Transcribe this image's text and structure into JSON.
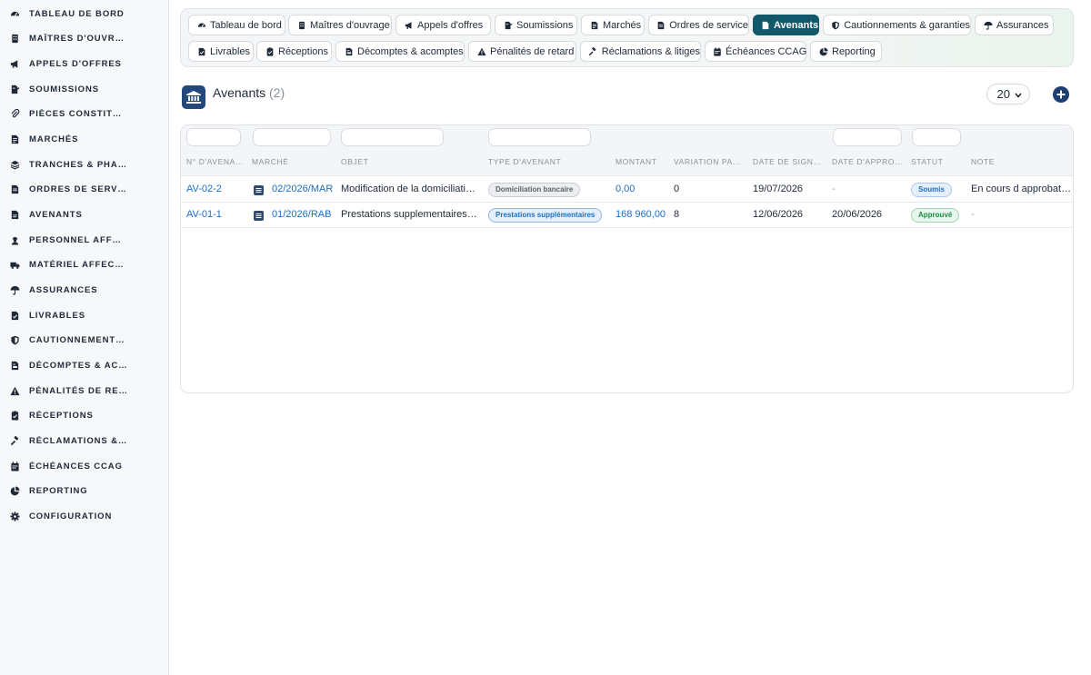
{
  "sidebar": {
    "items": [
      {
        "label": "Tableau de bord",
        "icon": "gauge-icon"
      },
      {
        "label": "Maîtres d'ouvrage",
        "icon": "building-icon"
      },
      {
        "label": "Appels d'offres",
        "icon": "megaphone-icon"
      },
      {
        "label": "Soumissions",
        "icon": "file-signature-icon"
      },
      {
        "label": "Pièces constitutives",
        "icon": "paperclip-icon"
      },
      {
        "label": "Marchés",
        "icon": "file-contract-icon"
      },
      {
        "label": "Tranches & phases",
        "icon": "layers-icon"
      },
      {
        "label": "Ordres de service",
        "icon": "file-lines-icon"
      },
      {
        "label": "Avenants",
        "icon": "file-icon"
      },
      {
        "label": "Personnel affecté",
        "icon": "user-hardhat-icon"
      },
      {
        "label": "Matériel affecté",
        "icon": "truck-icon"
      },
      {
        "label": "Assurances",
        "icon": "umbrella-icon"
      },
      {
        "label": "Livrables",
        "icon": "file-check-icon"
      },
      {
        "label": "Cautionnements & garanties",
        "icon": "shield-icon"
      },
      {
        "label": "Décomptes & acomptes",
        "icon": "invoice-icon"
      },
      {
        "label": "Pénalités de retard",
        "icon": "warning-icon"
      },
      {
        "label": "Réceptions",
        "icon": "clipboard-check-icon"
      },
      {
        "label": "Réclamations & litiges",
        "icon": "gavel-icon"
      },
      {
        "label": "Échéances CCAG",
        "icon": "calendar-icon"
      },
      {
        "label": "Reporting",
        "icon": "chart-pie-icon"
      },
      {
        "label": "Configuration",
        "icon": "gear-icon"
      }
    ]
  },
  "nav": {
    "tabs": [
      {
        "label": "Tableau de bord",
        "icon": "gauge-icon",
        "active": false
      },
      {
        "label": "Maîtres d'ouvrage",
        "icon": "building-icon",
        "active": false
      },
      {
        "label": "Appels d'offres",
        "icon": "megaphone-icon",
        "active": false
      },
      {
        "label": "Soumissions",
        "icon": "file-signature-icon",
        "active": false
      },
      {
        "label": "Marchés",
        "icon": "file-contract-icon",
        "active": false
      },
      {
        "label": "Ordres de service",
        "icon": "file-lines-icon",
        "active": false
      },
      {
        "label": "Avenants",
        "icon": "file-icon",
        "active": true
      },
      {
        "label": "Cautionnements & garanties",
        "icon": "shield-icon",
        "active": false
      },
      {
        "label": "Assurances",
        "icon": "umbrella-icon",
        "active": false
      },
      {
        "label": "Livrables",
        "icon": "file-check-icon",
        "active": false
      },
      {
        "label": "Réceptions",
        "icon": "clipboard-check-icon",
        "active": false
      },
      {
        "label": "Décomptes & acomptes",
        "icon": "invoice-icon",
        "active": false
      },
      {
        "label": "Pénalités de retard",
        "icon": "warning-icon",
        "active": false
      },
      {
        "label": "Réclamations & litiges",
        "icon": "gavel-icon",
        "active": false
      },
      {
        "label": "Échéances CCAG",
        "icon": "calendar-icon",
        "active": false
      },
      {
        "label": "Reporting",
        "icon": "chart-pie-icon",
        "active": false
      }
    ]
  },
  "header": {
    "title": "Avenants",
    "count": "(2)",
    "page_size": "20",
    "badge_icon": "bank-icon",
    "add_icon": "plus-circle-icon"
  },
  "table": {
    "columns": [
      "N° d'avenant",
      "Marché",
      "Objet",
      "Type d'avenant",
      "Montant",
      "Variation par...",
      "Date de signa...",
      "Date d'appro...",
      "Statut",
      "Note"
    ],
    "rows": [
      {
        "numero": "AV-02-2",
        "marche": "02/2026/MAR",
        "objet": "Modification de la domiciliation bancaire",
        "type": "Domiciliation bancaire",
        "montant": "0,00",
        "variation": "0",
        "date_signature": "19/07/2026",
        "date_approbation": "-",
        "statut": "Soumis",
        "note": "En cours d approbation"
      },
      {
        "numero": "AV-01-1",
        "marche": "01/2026/RAB",
        "objet": "Prestations supplementaires imprevues",
        "type": "Prestations supplémentaires",
        "montant": "168 960,00",
        "variation": "8",
        "date_signature": "12/06/2026",
        "date_approbation": "20/06/2026",
        "statut": "Approuvé",
        "note": "-"
      }
    ]
  },
  "colors": {
    "accent": "#11596a",
    "link": "#1a6fc4",
    "brand_dark": "#23497a",
    "status_soumis": "#1a6fc4",
    "status_approuve": "#1e8a43"
  }
}
